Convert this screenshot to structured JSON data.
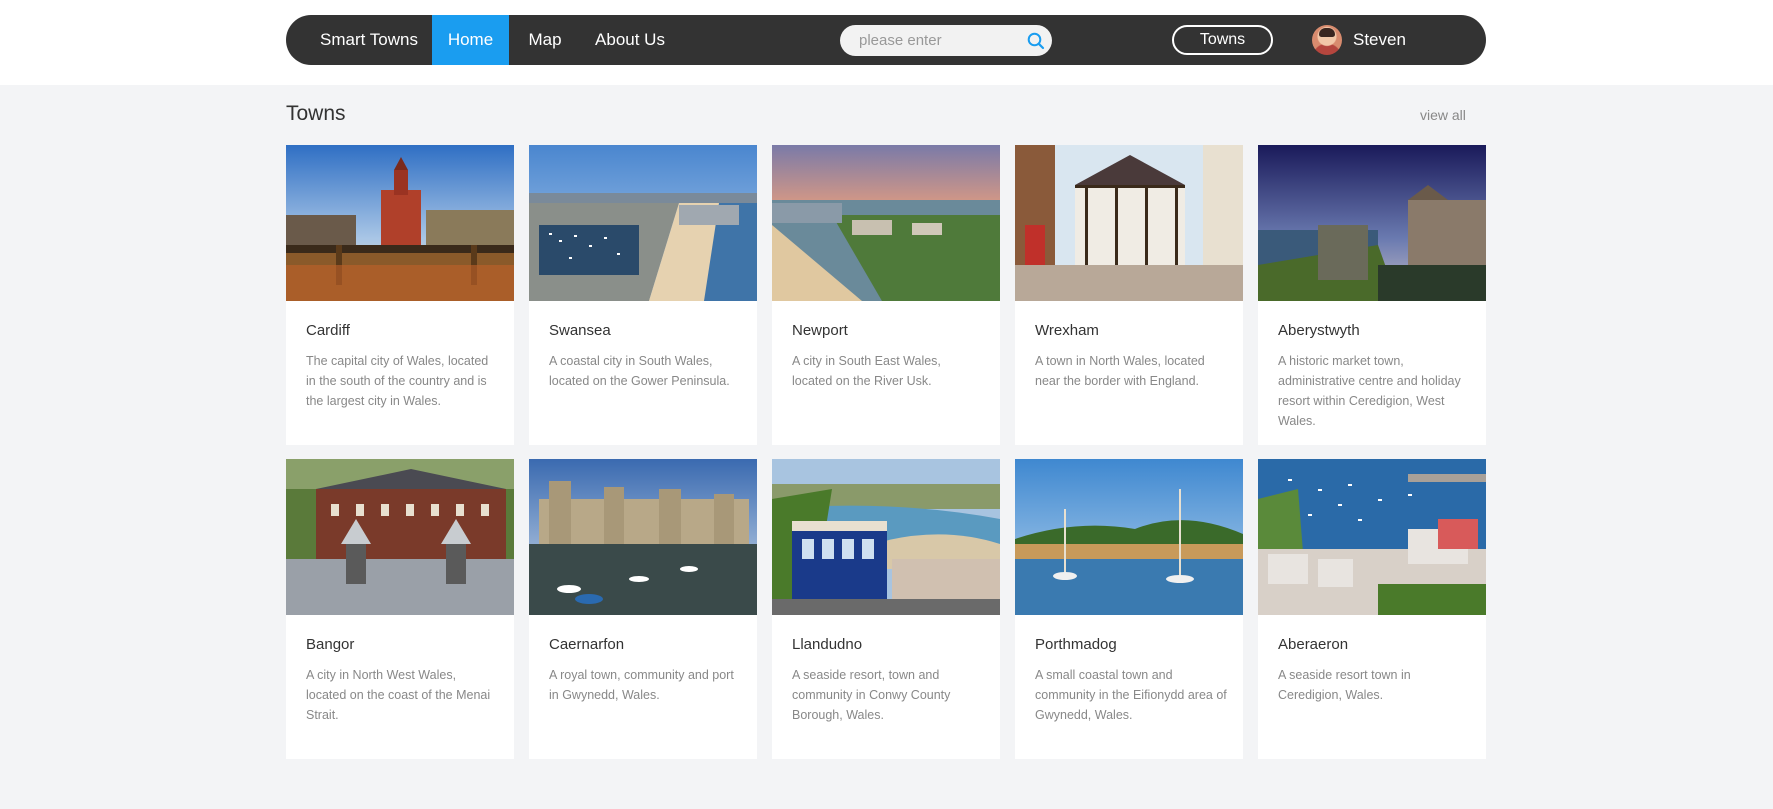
{
  "nav": {
    "brand": "Smart Towns",
    "items": [
      {
        "label": "Home",
        "active": true
      },
      {
        "label": "Map",
        "active": false
      },
      {
        "label": "About Us",
        "active": false
      }
    ],
    "search_placeholder": "please enter",
    "search_icon": "search-icon",
    "towns_button": "Towns",
    "username": "Steven"
  },
  "section": {
    "title": "Towns",
    "view_all": "view all"
  },
  "colors": {
    "nav_bg": "#333333",
    "accent": "#1a9df0",
    "page_bg": "#f3f4f6"
  },
  "towns": [
    {
      "name": "Cardiff",
      "description": "The capital city of Wales, located in the south of the country and is the largest city in Wales."
    },
    {
      "name": "Swansea",
      "description": "A coastal city in South Wales, located on the Gower Peninsula."
    },
    {
      "name": "Newport",
      "description": "A city in South East Wales, located on the River Usk."
    },
    {
      "name": "Wrexham",
      "description": "A town in North Wales, located near the border with England."
    },
    {
      "name": "Aberystwyth",
      "description": "A historic market town, administrative centre and holiday resort within Ceredigion, West Wales."
    },
    {
      "name": "Bangor",
      "description": "A city in North West Wales, located on the coast of the Menai Strait."
    },
    {
      "name": "Caernarfon",
      "description": "A royal town, community and port in Gwynedd, Wales."
    },
    {
      "name": "Llandudno",
      "description": "A seaside resort, town and community in Conwy County Borough, Wales."
    },
    {
      "name": "Porthmadog",
      "description": "A small coastal town and community in the Eifionydd area of Gwynedd, Wales."
    },
    {
      "name": "Aberaeron",
      "description": "A seaside resort town in Ceredigion, Wales."
    }
  ]
}
